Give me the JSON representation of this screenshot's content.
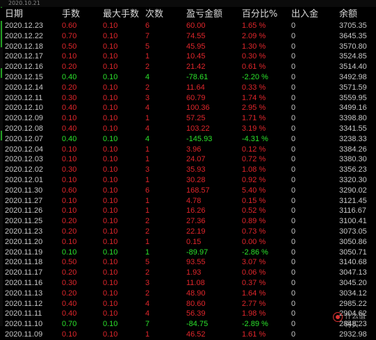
{
  "top_date": "2020.10.21",
  "headers": {
    "date": "日期",
    "qty": "手数",
    "max_qty": "最大手数",
    "count": "次数",
    "pnl": "盈亏金额",
    "pct": "百分比%",
    "inout": "出入金",
    "balance": "余额"
  },
  "rows": [
    {
      "date": "2020.12.23",
      "qty": "0.60",
      "max": "0.10",
      "count": "6",
      "pnl": "60.00",
      "pct": "1.65 %",
      "io": "0",
      "bal": "3705.35",
      "dir": "red"
    },
    {
      "date": "2020.12.22",
      "qty": "0.70",
      "max": "0.10",
      "count": "7",
      "pnl": "74.55",
      "pct": "2.09 %",
      "io": "0",
      "bal": "3645.35",
      "dir": "red"
    },
    {
      "date": "2020.12.18",
      "qty": "0.50",
      "max": "0.10",
      "count": "5",
      "pnl": "45.95",
      "pct": "1.30 %",
      "io": "0",
      "bal": "3570.80",
      "dir": "red"
    },
    {
      "date": "2020.12.17",
      "qty": "0.10",
      "max": "0.10",
      "count": "1",
      "pnl": "10.45",
      "pct": "0.30 %",
      "io": "0",
      "bal": "3524.85",
      "dir": "red"
    },
    {
      "date": "2020.12.16",
      "qty": "0.20",
      "max": "0.10",
      "count": "2",
      "pnl": "21.42",
      "pct": "0.61 %",
      "io": "0",
      "bal": "3514.40",
      "dir": "red"
    },
    {
      "date": "2020.12.15",
      "qty": "0.40",
      "max": "0.10",
      "count": "4",
      "pnl": "-78.61",
      "pct": "-2.20 %",
      "io": "0",
      "bal": "3492.98",
      "dir": "green"
    },
    {
      "date": "2020.12.14",
      "qty": "0.20",
      "max": "0.10",
      "count": "2",
      "pnl": "11.64",
      "pct": "0.33 %",
      "io": "0",
      "bal": "3571.59",
      "dir": "red"
    },
    {
      "date": "2020.12.11",
      "qty": "0.30",
      "max": "0.10",
      "count": "3",
      "pnl": "60.79",
      "pct": "1.74 %",
      "io": "0",
      "bal": "3559.95",
      "dir": "red"
    },
    {
      "date": "2020.12.10",
      "qty": "0.40",
      "max": "0.10",
      "count": "4",
      "pnl": "100.36",
      "pct": "2.95 %",
      "io": "0",
      "bal": "3499.16",
      "dir": "red"
    },
    {
      "date": "2020.12.09",
      "qty": "0.10",
      "max": "0.10",
      "count": "1",
      "pnl": "57.25",
      "pct": "1.71 %",
      "io": "0",
      "bal": "3398.80",
      "dir": "red"
    },
    {
      "date": "2020.12.08",
      "qty": "0.40",
      "max": "0.10",
      "count": "4",
      "pnl": "103.22",
      "pct": "3.19 %",
      "io": "0",
      "bal": "3341.55",
      "dir": "red"
    },
    {
      "date": "2020.12.07",
      "qty": "0.40",
      "max": "0.10",
      "count": "4",
      "pnl": "-145.93",
      "pct": "-4.31 %",
      "io": "0",
      "bal": "3238.33",
      "dir": "green"
    },
    {
      "date": "2020.12.04",
      "qty": "0.10",
      "max": "0.10",
      "count": "1",
      "pnl": "3.96",
      "pct": "0.12 %",
      "io": "0",
      "bal": "3384.26",
      "dir": "red"
    },
    {
      "date": "2020.12.03",
      "qty": "0.10",
      "max": "0.10",
      "count": "1",
      "pnl": "24.07",
      "pct": "0.72 %",
      "io": "0",
      "bal": "3380.30",
      "dir": "red"
    },
    {
      "date": "2020.12.02",
      "qty": "0.30",
      "max": "0.10",
      "count": "3",
      "pnl": "35.93",
      "pct": "1.08 %",
      "io": "0",
      "bal": "3356.23",
      "dir": "red"
    },
    {
      "date": "2020.12.01",
      "qty": "0.10",
      "max": "0.10",
      "count": "1",
      "pnl": "30.28",
      "pct": "0.92 %",
      "io": "0",
      "bal": "3320.30",
      "dir": "red"
    },
    {
      "date": "2020.11.30",
      "qty": "0.60",
      "max": "0.10",
      "count": "6",
      "pnl": "168.57",
      "pct": "5.40 %",
      "io": "0",
      "bal": "3290.02",
      "dir": "red"
    },
    {
      "date": "2020.11.27",
      "qty": "0.10",
      "max": "0.10",
      "count": "1",
      "pnl": "4.78",
      "pct": "0.15 %",
      "io": "0",
      "bal": "3121.45",
      "dir": "red"
    },
    {
      "date": "2020.11.26",
      "qty": "0.10",
      "max": "0.10",
      "count": "1",
      "pnl": "16.26",
      "pct": "0.52 %",
      "io": "0",
      "bal": "3116.67",
      "dir": "red"
    },
    {
      "date": "2020.11.25",
      "qty": "0.20",
      "max": "0.10",
      "count": "2",
      "pnl": "27.36",
      "pct": "0.89 %",
      "io": "0",
      "bal": "3100.41",
      "dir": "red"
    },
    {
      "date": "2020.11.23",
      "qty": "0.20",
      "max": "0.10",
      "count": "2",
      "pnl": "22.19",
      "pct": "0.73 %",
      "io": "0",
      "bal": "3073.05",
      "dir": "red"
    },
    {
      "date": "2020.11.20",
      "qty": "0.10",
      "max": "0.10",
      "count": "1",
      "pnl": "0.15",
      "pct": "0.00 %",
      "io": "0",
      "bal": "3050.86",
      "dir": "red"
    },
    {
      "date": "2020.11.19",
      "qty": "0.10",
      "max": "0.10",
      "count": "1",
      "pnl": "-89.97",
      "pct": "-2.86 %",
      "io": "0",
      "bal": "3050.71",
      "dir": "green"
    },
    {
      "date": "2020.11.18",
      "qty": "0.50",
      "max": "0.10",
      "count": "5",
      "pnl": "93.55",
      "pct": "3.07 %",
      "io": "0",
      "bal": "3140.68",
      "dir": "red"
    },
    {
      "date": "2020.11.17",
      "qty": "0.20",
      "max": "0.10",
      "count": "2",
      "pnl": "1.93",
      "pct": "0.06 %",
      "io": "0",
      "bal": "3047.13",
      "dir": "red"
    },
    {
      "date": "2020.11.16",
      "qty": "0.30",
      "max": "0.10",
      "count": "3",
      "pnl": "11.08",
      "pct": "0.37 %",
      "io": "0",
      "bal": "3045.20",
      "dir": "red"
    },
    {
      "date": "2020.11.13",
      "qty": "0.20",
      "max": "0.10",
      "count": "2",
      "pnl": "48.90",
      "pct": "1.64 %",
      "io": "0",
      "bal": "3034.12",
      "dir": "red"
    },
    {
      "date": "2020.11.12",
      "qty": "0.40",
      "max": "0.10",
      "count": "4",
      "pnl": "80.60",
      "pct": "2.77 %",
      "io": "0",
      "bal": "2985.22",
      "dir": "red"
    },
    {
      "date": "2020.11.11",
      "qty": "0.40",
      "max": "0.10",
      "count": "4",
      "pnl": "56.39",
      "pct": "1.98 %",
      "io": "0",
      "bal": "2904.62",
      "dir": "red"
    },
    {
      "date": "2020.11.10",
      "qty": "0.70",
      "max": "0.10",
      "count": "7",
      "pnl": "-84.75",
      "pct": "-2.89 %",
      "io": "0",
      "bal": "2848.23",
      "dir": "green"
    },
    {
      "date": "2020.11.09",
      "qty": "0.10",
      "max": "0.10",
      "count": "1",
      "pnl": "46.52",
      "pct": "1.61 %",
      "io": "0",
      "bal": "2932.98",
      "dir": "red"
    }
  ],
  "colors": {
    "positive": "#e0262b",
    "negative": "#2be22b",
    "text": "#c8c8c8",
    "background": "#000000"
  },
  "watermark": {
    "text": "什么值得买",
    "icon": "logo-icon"
  }
}
